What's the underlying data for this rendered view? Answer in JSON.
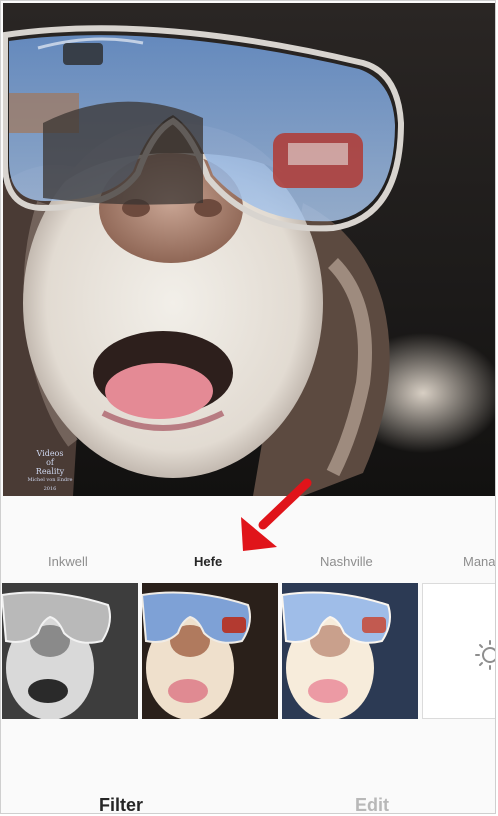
{
  "filters": {
    "names": [
      "Inkwell",
      "Hefe",
      "Nashville",
      "Mana"
    ],
    "active": "Hefe"
  },
  "watermark": {
    "line1": "Videos",
    "line2": "of",
    "line3": "Reality",
    "line4": "Michel von Endre 2016"
  },
  "tabs": {
    "filter_label": "Filter",
    "edit_label": "Edit"
  },
  "colors": {
    "arrow": "#e0141a",
    "active_text": "#262626",
    "inactive_text": "#8e8e8e",
    "edit_text": "#b8b8b8"
  },
  "icons": {
    "adjust": "sun-icon"
  }
}
